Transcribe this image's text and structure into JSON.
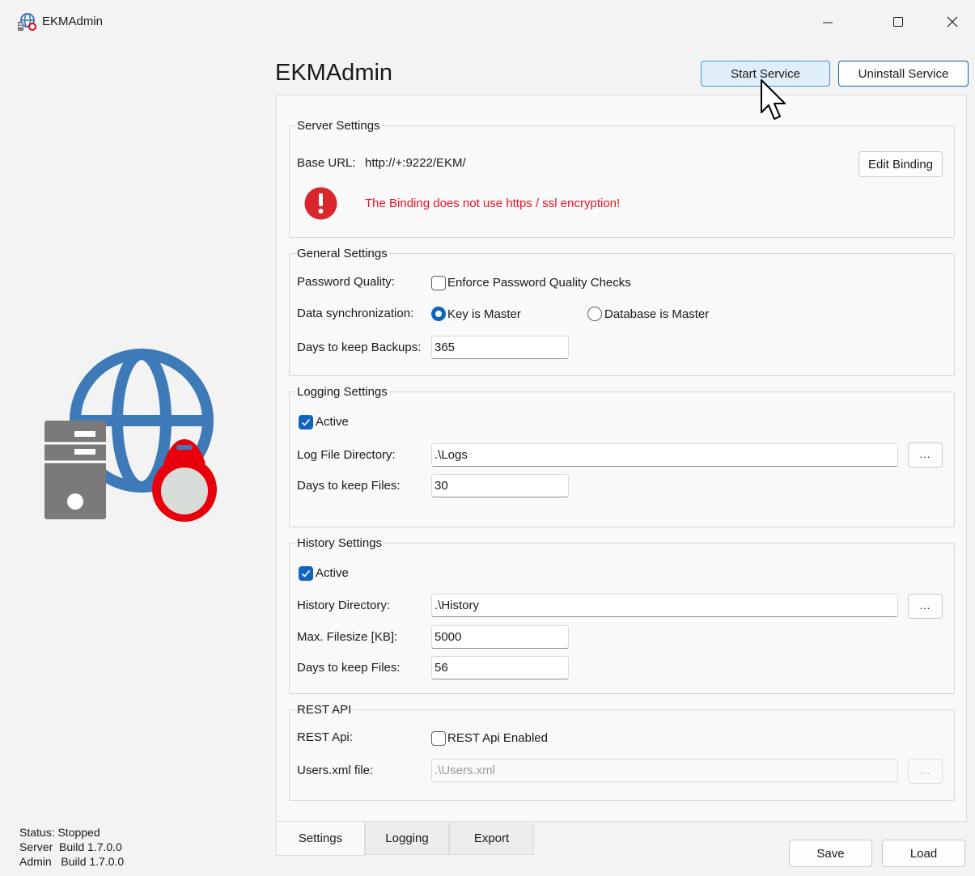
{
  "window": {
    "title": "EKMAdmin",
    "minimize_glyph": "—",
    "maximize_glyph": "☐",
    "close_glyph": "✕"
  },
  "header": {
    "title": "EKMAdmin",
    "start_service_label": "Start Service",
    "uninstall_service_label": "Uninstall Service"
  },
  "server_settings": {
    "legend": "Server Settings",
    "base_url_label": "Base URL:",
    "base_url_value": "http://+:9222/EKM/",
    "edit_binding_label": "Edit Binding",
    "warning_text": "The Binding does not use https / ssl encryption!",
    "warning_icon_glyph": "!"
  },
  "general_settings": {
    "legend": "General Settings",
    "password_quality_label": "Password Quality:",
    "enforce_checkbox_label": "Enforce Password Quality Checks",
    "enforce_checked": false,
    "data_sync_label": "Data synchronization:",
    "key_master_label": "Key is Master",
    "database_master_label": "Database is Master",
    "selected_sync": "Key is Master",
    "days_backups_label": "Days to keep Backups:",
    "days_backups_value": "365"
  },
  "logging_settings": {
    "legend": "Logging Settings",
    "active_label": "Active",
    "active_checked": true,
    "log_dir_label": "Log File Directory:",
    "log_dir_value": ".\\Logs",
    "browse_label": "...",
    "days_files_label": "Days to keep Files:",
    "days_files_value": "30"
  },
  "history_settings": {
    "legend": "History Settings",
    "active_label": "Active",
    "active_checked": true,
    "history_dir_label": "History Directory:",
    "history_dir_value": ".\\History",
    "browse_label": "...",
    "max_filesize_label": "Max. Filesize [KB]:",
    "max_filesize_value": "5000",
    "days_files_label": "Days to keep Files:",
    "days_files_value": "56"
  },
  "rest_api": {
    "legend": "REST API",
    "rest_api_label": "REST Api:",
    "enabled_label": "REST Api Enabled",
    "enabled_checked": false,
    "users_file_label": "Users.xml file:",
    "users_file_value": ".\\Users.xml",
    "browse_label": "..."
  },
  "tabs": [
    {
      "label": "Settings",
      "active": true
    },
    {
      "label": "Logging",
      "active": false
    },
    {
      "label": "Export",
      "active": false
    }
  ],
  "footer": {
    "save_label": "Save",
    "load_label": "Load"
  },
  "status": {
    "status_line": "Status: Stopped",
    "server_line": "Server  Build 1.7.0.0",
    "admin_line": "Admin   Build 1.7.0.0"
  },
  "colors": {
    "accent": "#0f64c0",
    "error": "#e81123",
    "globe": "#3d7ab7",
    "server_grey": "#7a7a7a",
    "key_red": "#e8000b"
  },
  "icons": {
    "app": "globe-server-key-icon",
    "logo": "globe-server-key-logo",
    "warning": "error-circle-icon",
    "cursor": "mouse-pointer-icon"
  }
}
